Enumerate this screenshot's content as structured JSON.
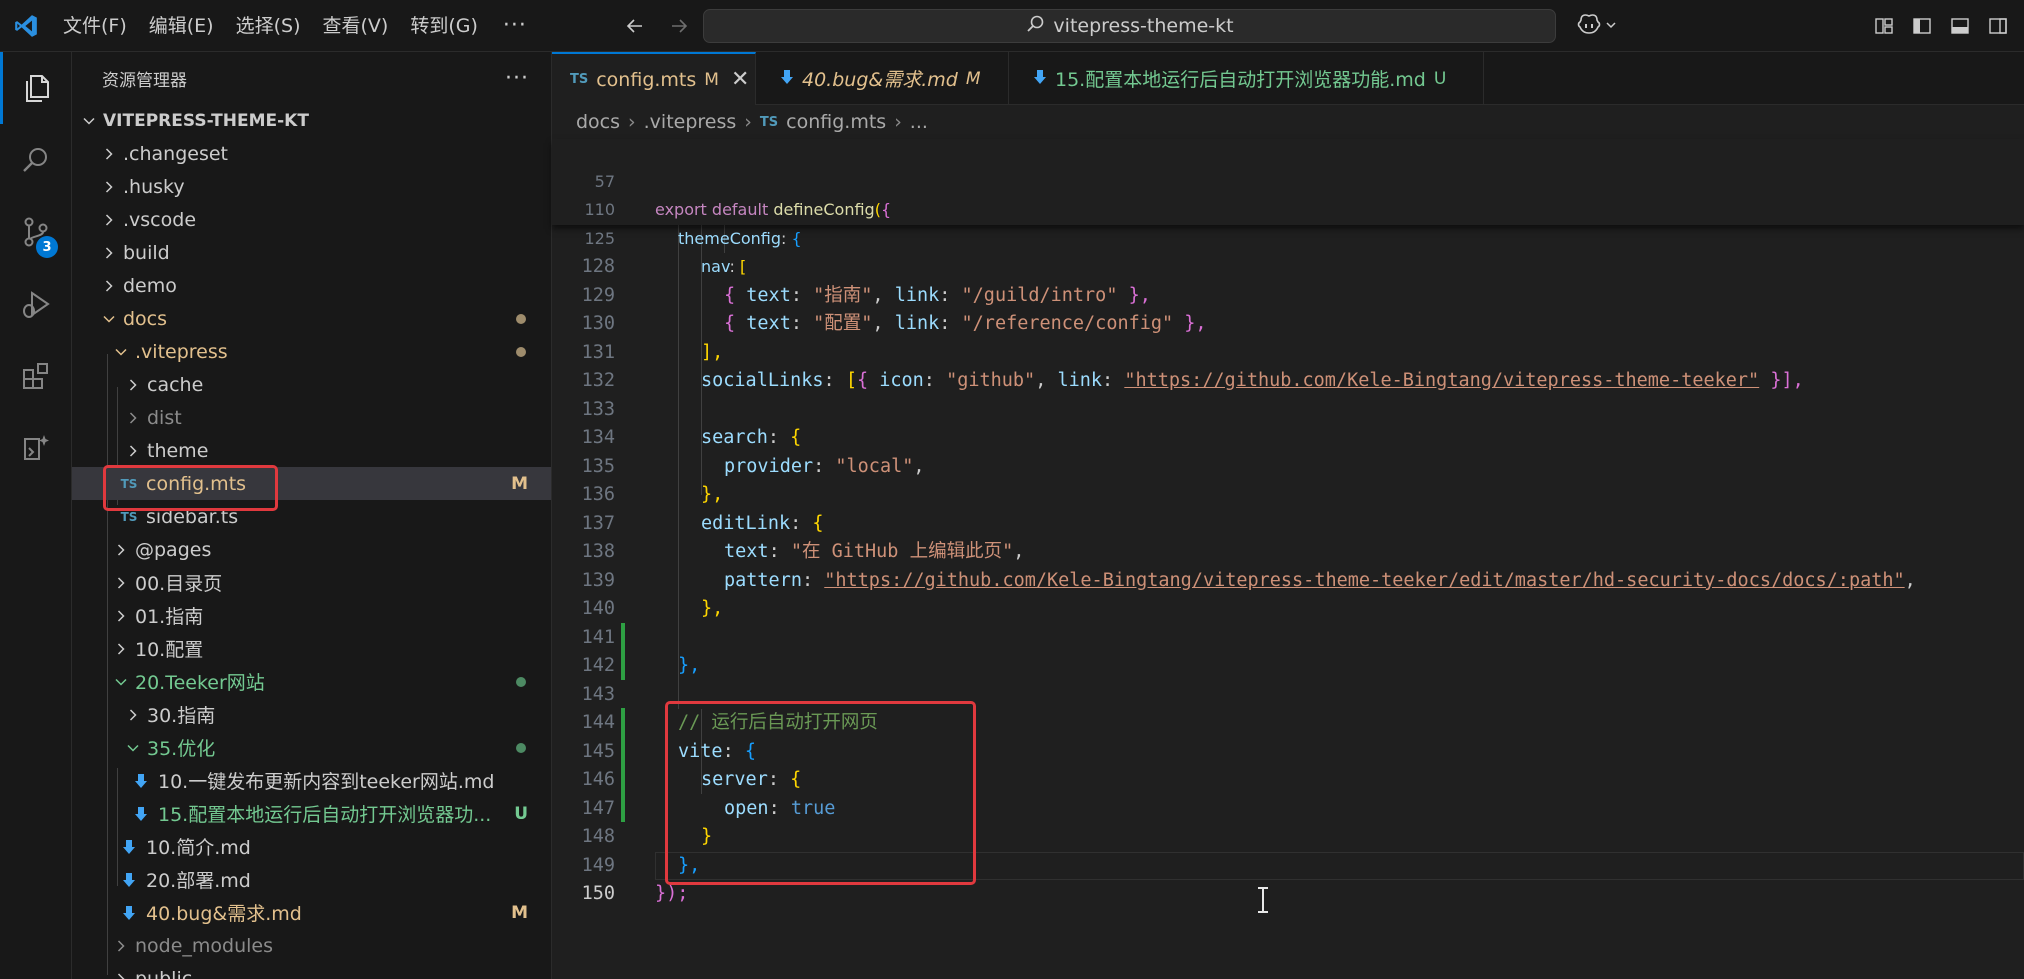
{
  "titlebar": {
    "menu": [
      "文件(F)",
      "编辑(E)",
      "选择(S)",
      "查看(V)",
      "转到(G)"
    ],
    "more": "···",
    "search": "vitepress-theme-kt"
  },
  "activity": {
    "source_control_badge": "3"
  },
  "sidebar": {
    "title": "资源管理器",
    "more": "···",
    "root": "VITEPRESS-THEME-KT",
    "rows": [
      {
        "label": ".changeset",
        "badge": ""
      },
      {
        "label": ".husky",
        "badge": ""
      },
      {
        "label": ".vscode",
        "badge": ""
      },
      {
        "label": "build",
        "badge": ""
      },
      {
        "label": "demo",
        "badge": ""
      },
      {
        "label": "docs",
        "badge": ""
      },
      {
        "label": ".vitepress",
        "badge": ""
      },
      {
        "label": "cache",
        "badge": ""
      },
      {
        "label": "dist",
        "badge": ""
      },
      {
        "label": "theme",
        "badge": ""
      },
      {
        "label": "config.mts",
        "badge": "M"
      },
      {
        "label": "sidebar.ts",
        "badge": ""
      },
      {
        "label": "@pages",
        "badge": ""
      },
      {
        "label": "00.目录页",
        "badge": ""
      },
      {
        "label": "01.指南",
        "badge": ""
      },
      {
        "label": "10.配置",
        "badge": ""
      },
      {
        "label": "20.Teeker网站",
        "badge": ""
      },
      {
        "label": "30.指南",
        "badge": ""
      },
      {
        "label": "35.优化",
        "badge": ""
      },
      {
        "label": "10.一键发布更新内容到teeker网站.md",
        "badge": ""
      },
      {
        "label": "15.配置本地运行后自动打开浏览器功...",
        "badge": "U"
      },
      {
        "label": "10.简介.md",
        "badge": ""
      },
      {
        "label": "20.部署.md",
        "badge": ""
      },
      {
        "label": "40.bug&需求.md",
        "badge": "M"
      },
      {
        "label": "node_modules",
        "badge": ""
      },
      {
        "label": "public",
        "badge": ""
      }
    ]
  },
  "tabs": [
    {
      "icon": "TS",
      "label": "config.mts",
      "state": "M",
      "close": "✕"
    },
    {
      "icon": "",
      "label": "40.bug&需求.md",
      "state": "M"
    },
    {
      "icon": "",
      "label": "15.配置本地运行后自动打开浏览器功能.md",
      "state": "U"
    }
  ],
  "breadcrumb": {
    "a": "docs",
    "b": ".vitepress",
    "icon": "TS",
    "c": "config.mts",
    "d": "...",
    "sep": "›"
  },
  "code": {
    "line_numbers": [
      "57",
      "110",
      "125",
      "128",
      "129",
      "130",
      "131",
      "132",
      "133",
      "134",
      "135",
      "136",
      "137",
      "138",
      "139",
      "140",
      "141",
      "142",
      "143",
      "144",
      "145",
      "146",
      "147",
      "148",
      "149",
      "150"
    ],
    "sticky": {
      "l57": {
        "a": "export",
        "b": "default",
        "c": "defineConfig",
        "d": "(",
        "e": "{"
      },
      "l110": {
        "a": "themeConfig",
        "b": ":",
        "c": "{"
      },
      "l125": {
        "a": "nav",
        "b": ":",
        "c": "["
      }
    },
    "t_text": "text",
    "t_link": "link",
    "t_colon": ":",
    "t_comma": ",",
    "t_lbrace": "{",
    "t_rbrace": "}",
    "t_rbrace_comma": "},",
    "guide_str": "\"指南\"",
    "guide_link": "\"/guild/intro\"",
    "config_str": "\"配置\"",
    "config_link": "\"/reference/config\"",
    "close_nav": "],",
    "social": "socialLinks",
    "icon_key": "icon",
    "github_str": "\"github\"",
    "social_url": "\"https://github.com/Kele-Bingtang/vitepress-theme-teeker\"",
    "close_social": "}],",
    "search": "search",
    "provider": "provider",
    "local_str": "\"local\"",
    "editlink": "editLink",
    "edit_text": "\"在 GitHub 上编辑此页\"",
    "pattern": "pattern",
    "pattern_url": "\"https://github.com/Kele-Bingtang/vitepress-theme-teeker/edit/master/hd-security-docs/docs/:path\"",
    "comment": "// 运行后自动打开网页",
    "vite": "vite",
    "server": "server",
    "open": "open",
    "true_val": "true",
    "final": "});"
  }
}
